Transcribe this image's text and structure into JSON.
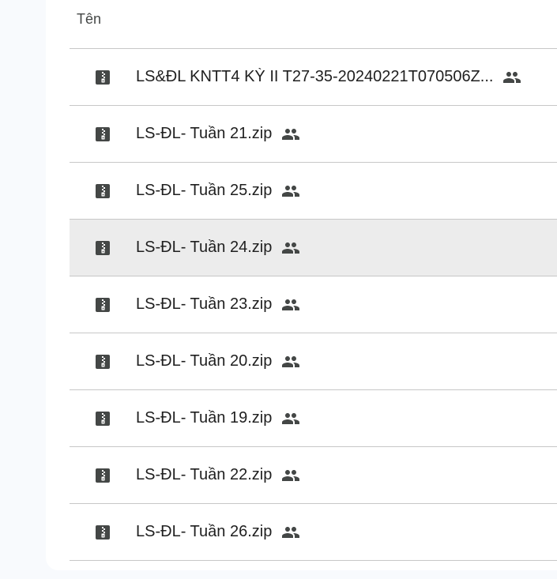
{
  "list": {
    "header": {
      "name_column": "Tên"
    },
    "files": [
      {
        "name": "LS&ĐL KNTT4 KỲ II T27-35-20240221T070506Z...",
        "icon": "zip-file-icon",
        "shared_icon": "people-icon",
        "selected": false
      },
      {
        "name": "LS-ĐL- Tuần 21.zip",
        "icon": "zip-file-icon",
        "shared_icon": "people-icon",
        "selected": false
      },
      {
        "name": "LS-ĐL- Tuần 25.zip",
        "icon": "zip-file-icon",
        "shared_icon": "people-icon",
        "selected": false
      },
      {
        "name": "LS-ĐL- Tuần 24.zip",
        "icon": "zip-file-icon",
        "shared_icon": "people-icon",
        "selected": true
      },
      {
        "name": "LS-ĐL- Tuần 23.zip",
        "icon": "zip-file-icon",
        "shared_icon": "people-icon",
        "selected": false
      },
      {
        "name": "LS-ĐL- Tuần 20.zip",
        "icon": "zip-file-icon",
        "shared_icon": "people-icon",
        "selected": false
      },
      {
        "name": "LS-ĐL- Tuần 19.zip",
        "icon": "zip-file-icon",
        "shared_icon": "people-icon",
        "selected": false
      },
      {
        "name": "LS-ĐL- Tuần 22.zip",
        "icon": "zip-file-icon",
        "shared_icon": "people-icon",
        "selected": false
      },
      {
        "name": "LS-ĐL- Tuần 26.zip",
        "icon": "zip-file-icon",
        "shared_icon": "people-icon",
        "selected": false
      }
    ]
  },
  "colors": {
    "page_background": "#f8fafd",
    "panel_background": "#ffffff",
    "selected_row": "#ececec",
    "divider": "#c7c7c7",
    "icon": "#444746",
    "text": "#1f1f1f"
  }
}
